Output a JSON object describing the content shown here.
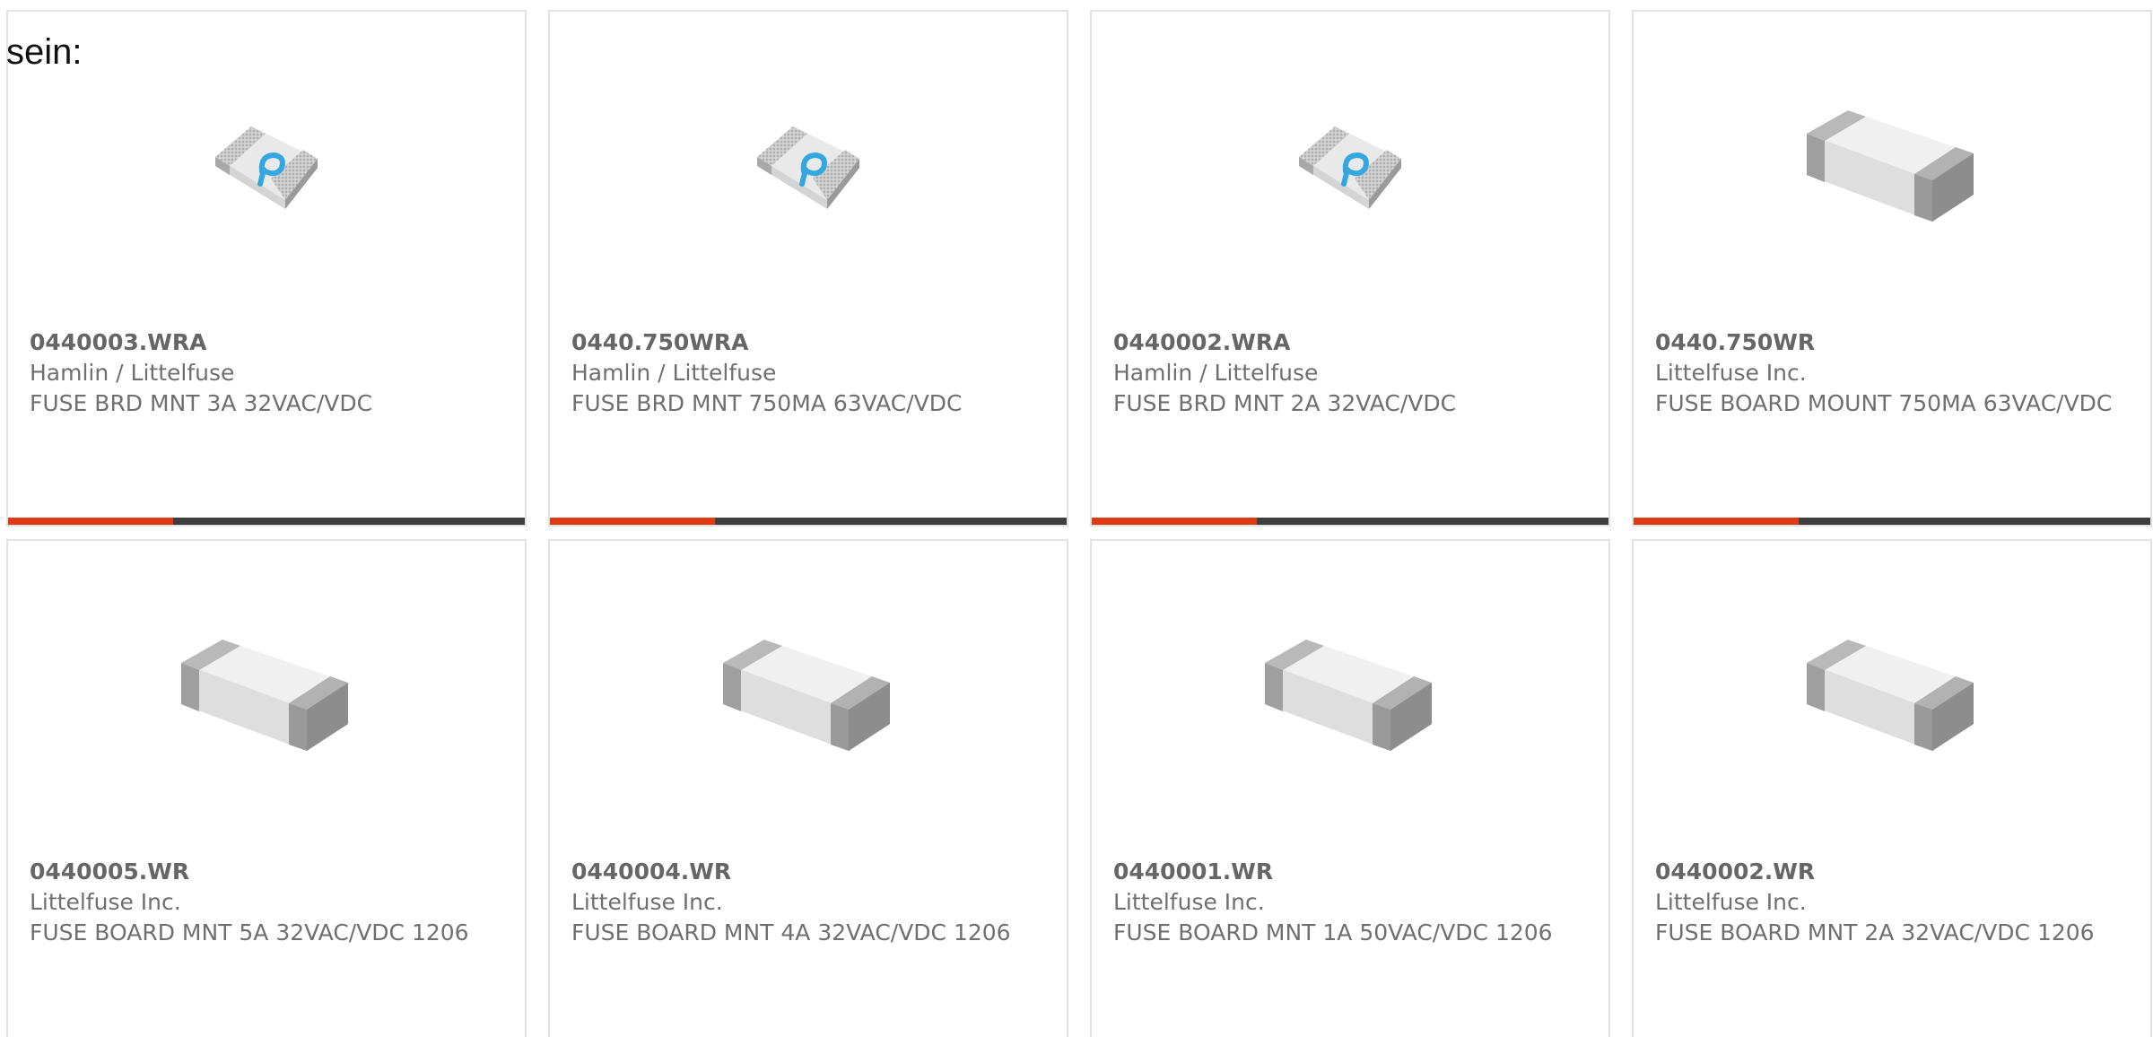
{
  "lead_text": "sein:",
  "colors": {
    "card_border": "#e3e3e3",
    "accent": "#e03a12",
    "bar_dark": "#3e3e3e",
    "text": "#6f6f6f"
  },
  "products": [
    {
      "part": "0440003.WRA",
      "manufacturer": "Hamlin / Littelfuse",
      "description": "FUSE BRD MNT 3A 32VAC/VDC",
      "image_icon": "fuse-chip-icon-marked",
      "progress": 0.32
    },
    {
      "part": "0440.750WRA",
      "manufacturer": "Hamlin / Littelfuse",
      "description": "FUSE BRD MNT 750MA 63VAC/VDC",
      "image_icon": "fuse-chip-icon-marked",
      "progress": 0.32
    },
    {
      "part": "0440002.WRA",
      "manufacturer": "Hamlin / Littelfuse",
      "description": "FUSE BRD MNT 2A 32VAC/VDC",
      "image_icon": "fuse-chip-icon-marked",
      "progress": 0.32
    },
    {
      "part": "0440.750WR",
      "manufacturer": "Littelfuse Inc.",
      "description": "FUSE BOARD MOUNT 750MA 63VAC/VDC",
      "image_icon": "fuse-chip-icon-plain",
      "progress": 0.32
    },
    {
      "part": "0440005.WR",
      "manufacturer": "Littelfuse Inc.",
      "description": "FUSE BOARD MNT 5A 32VAC/VDC 1206",
      "image_icon": "fuse-chip-icon-plain",
      "progress": null
    },
    {
      "part": "0440004.WR",
      "manufacturer": "Littelfuse Inc.",
      "description": "FUSE BOARD MNT 4A 32VAC/VDC 1206",
      "image_icon": "fuse-chip-icon-plain",
      "progress": null
    },
    {
      "part": "0440001.WR",
      "manufacturer": "Littelfuse Inc.",
      "description": "FUSE BOARD MNT 1A 50VAC/VDC 1206",
      "image_icon": "fuse-chip-icon-plain",
      "progress": null
    },
    {
      "part": "0440002.WR",
      "manufacturer": "Littelfuse Inc.",
      "description": "FUSE BOARD MNT 2A 32VAC/VDC 1206",
      "image_icon": "fuse-chip-icon-plain",
      "progress": null
    }
  ]
}
